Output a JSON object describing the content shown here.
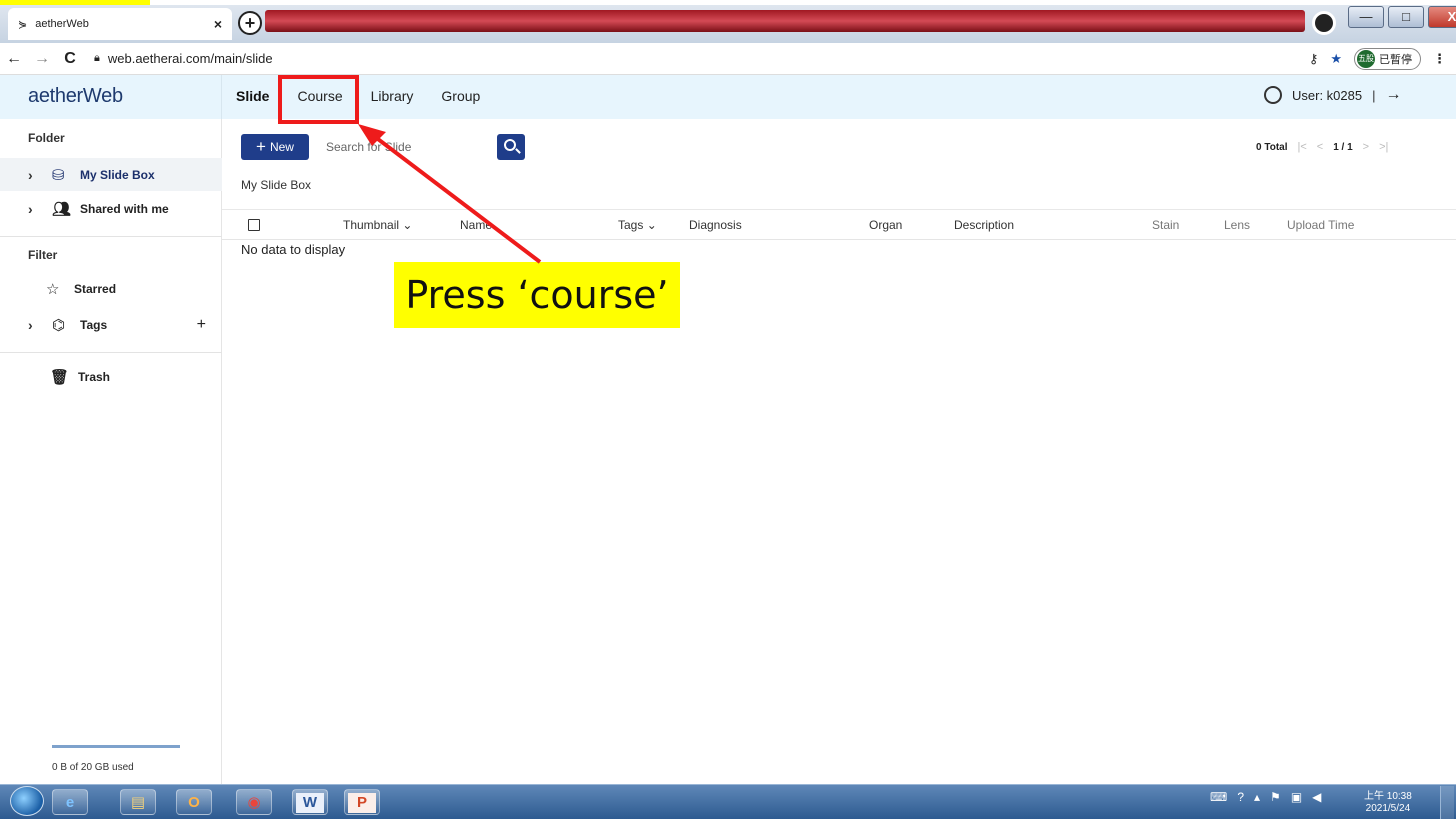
{
  "browser": {
    "tab_title": "aetherWeb",
    "tab_close": "×",
    "new_tab": "+",
    "url": "web.aetherai.com/main/slide",
    "profile_initials": "五股",
    "paused_label": "已暫停",
    "window_controls": [
      "—",
      "□",
      "X"
    ]
  },
  "app": {
    "brand": "aetherWeb",
    "nav_tabs": [
      {
        "label": "Slide",
        "active": true
      },
      {
        "label": "Course",
        "active": false
      },
      {
        "label": "Library",
        "active": false
      },
      {
        "label": "Group",
        "active": false
      }
    ],
    "user_label": "User: k0285",
    "user_sep": "|",
    "logout_icon": "→"
  },
  "sidebar": {
    "folder_heading": "Folder",
    "my_slide_box": "My Slide Box",
    "shared_with_me": "Shared with me",
    "filter_heading": "Filter",
    "starred": "Starred",
    "tags": "Tags",
    "tags_add": "+",
    "trash": "Trash",
    "storage": "0 B of 20 GB used"
  },
  "main": {
    "new_label": "New",
    "search_placeholder": "Search for Slide",
    "breadcrumb": "My Slide Box",
    "total": "0 Total",
    "page": "1 / 1",
    "columns": {
      "thumbnail": "Thumbnail",
      "name": "Name",
      "tags": "Tags",
      "diagnosis": "Diagnosis",
      "organ": "Organ",
      "description": "Description",
      "stain": "Stain",
      "lens": "Lens",
      "upload_time": "Upload Time"
    },
    "empty": "No data to display"
  },
  "annotation": {
    "callout": "Press ‘course’",
    "highlight_color": "#ee1b1b",
    "callout_bg": "#ffff00"
  },
  "taskbar": {
    "apps": [
      "ie-icon",
      "explorer-icon",
      "outlook-icon",
      "chrome-icon",
      "word-icon",
      "powerpoint-icon"
    ],
    "time": "上午 10:38",
    "date": "2021/5/24"
  },
  "colors": {
    "accent": "#1f3d8a",
    "header_bg": "#e7f5fd",
    "brand": "#1e3a6e"
  }
}
